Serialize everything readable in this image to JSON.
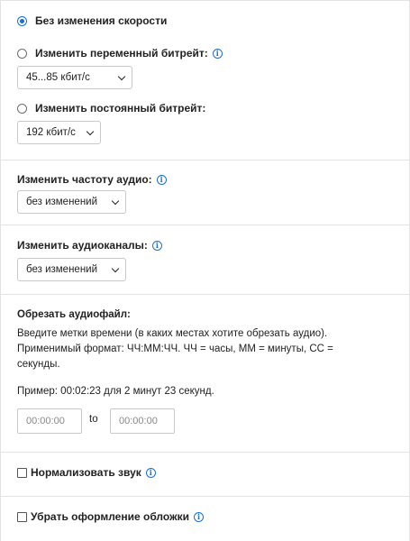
{
  "bitrate": {
    "option_none": "Без изменения скорости",
    "option_variable": "Изменить переменный битрейт:",
    "variable_value": "45...85 кбит/с",
    "option_constant": "Изменить постоянный битрейт:",
    "constant_value": "192 кбит/с"
  },
  "frequency": {
    "label": "Изменить частоту аудио:",
    "value": "без изменений"
  },
  "channels": {
    "label": "Изменить аудиоканалы:",
    "value": "без изменений"
  },
  "trim": {
    "label": "Обрезать аудиофайл:",
    "description_line1": "Введите метки времени (в каких местах хотите обрезать аудио).",
    "description_line2": "Применимый формат: ЧЧ:ММ:ЧЧ. ЧЧ = часы, ММ = минуты, СС =",
    "description_line3": "секунды.",
    "example": "Пример: 00:02:23 для 2 минут 23 секунд.",
    "start_placeholder": "00:00:00",
    "to_label": "to",
    "end_placeholder": "00:00:00"
  },
  "normalize": {
    "label": "Нормализовать звук"
  },
  "cover": {
    "label": "Убрать оформление обложки"
  },
  "info_glyph": "i",
  "colors": {
    "accent": "#1a6fd6",
    "border": "#e3e3e3"
  }
}
